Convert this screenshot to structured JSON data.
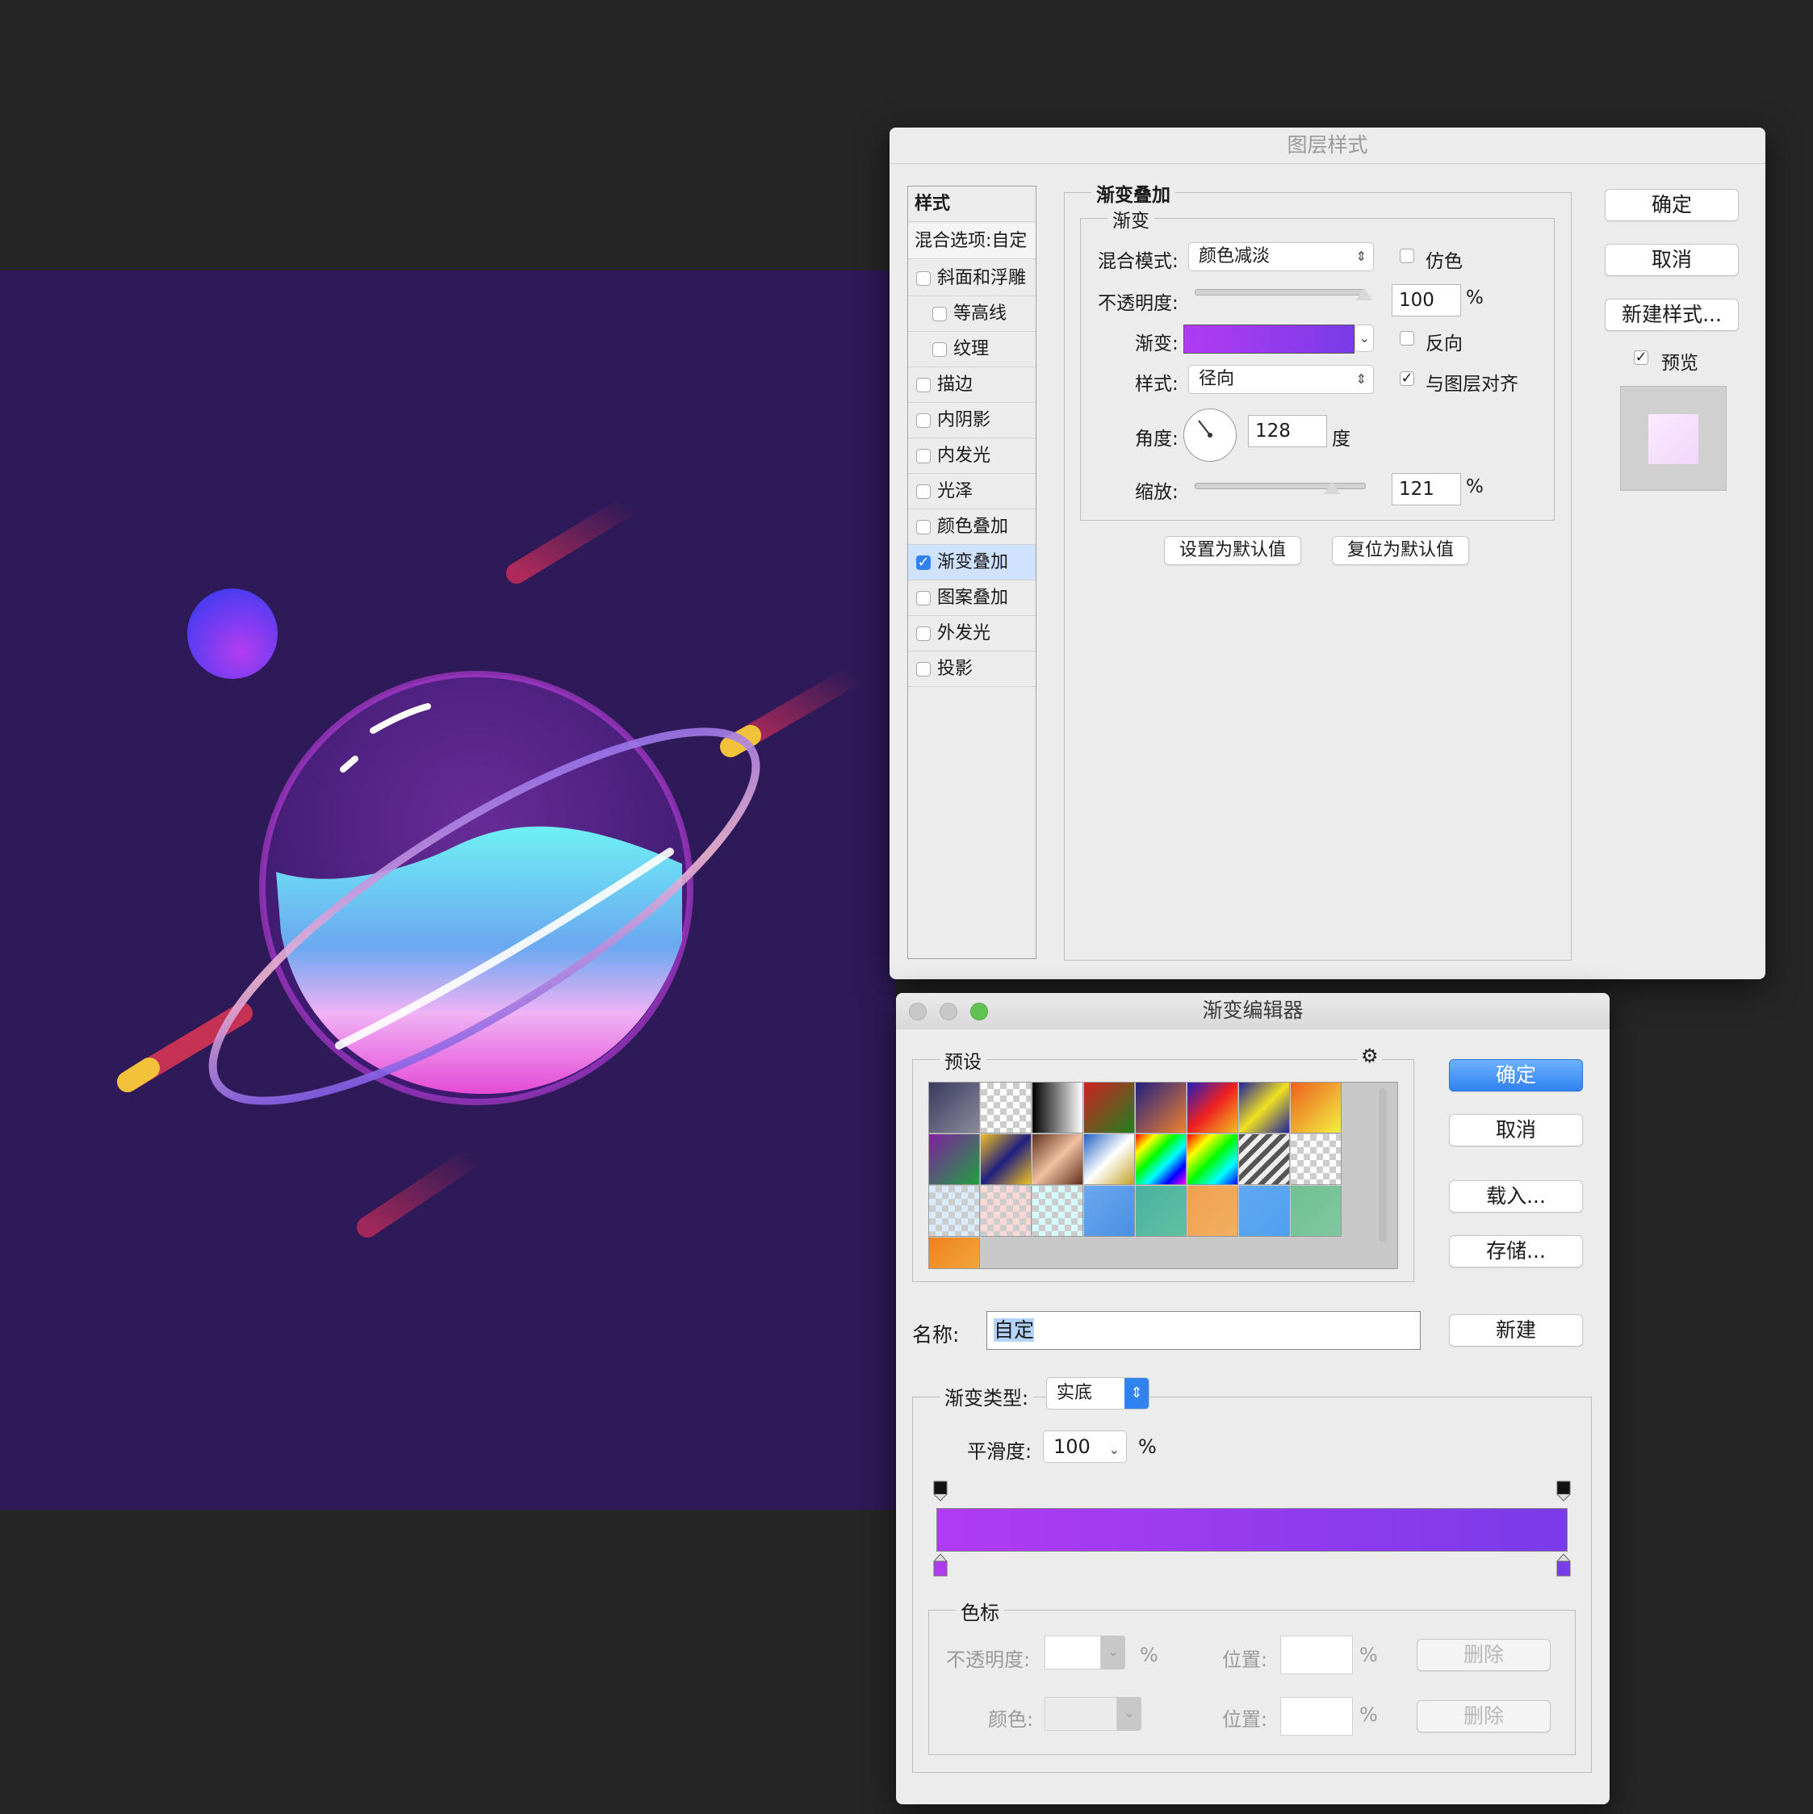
{
  "layer_style": {
    "title": "图层样式",
    "styles_header": "样式",
    "blend_options": "混合选项:自定",
    "items": [
      {
        "label": "斜面和浮雕",
        "checked": false
      },
      {
        "label": "等高线",
        "checked": false
      },
      {
        "label": "纹理",
        "checked": false
      },
      {
        "label": "描边",
        "checked": false
      },
      {
        "label": "内阴影",
        "checked": false
      },
      {
        "label": "内发光",
        "checked": false
      },
      {
        "label": "光泽",
        "checked": false
      },
      {
        "label": "颜色叠加",
        "checked": false
      },
      {
        "label": "渐变叠加",
        "checked": true
      },
      {
        "label": "图案叠加",
        "checked": false
      },
      {
        "label": "外发光",
        "checked": false
      },
      {
        "label": "投影",
        "checked": false
      }
    ],
    "section_title": "渐变叠加",
    "subsection_title": "渐变",
    "blend_mode_label": "混合模式:",
    "blend_mode_value": "颜色减淡",
    "dither_label": "仿色",
    "opacity_label": "不透明度:",
    "opacity_value": "100",
    "percent": "%",
    "gradient_label": "渐变:",
    "reverse_label": "反向",
    "style_label": "样式:",
    "style_value": "径向",
    "align_label": "与图层对齐",
    "angle_label": "角度:",
    "angle_value": "128",
    "degree": "度",
    "scale_label": "缩放:",
    "scale_value": "121",
    "set_default": "设置为默认值",
    "reset_default": "复位为默认值",
    "ok": "确定",
    "cancel": "取消",
    "new_style": "新建样式...",
    "preview_label": "预览",
    "opacity_fraction": 1.0,
    "scale_fraction": 0.81
  },
  "gradient_editor": {
    "title": "渐变编辑器",
    "presets_label": "预设",
    "ok": "确定",
    "cancel": "取消",
    "load": "载入...",
    "save": "存储...",
    "name_label": "名称:",
    "name_value": "自定",
    "new": "新建",
    "type_label": "渐变类型:",
    "type_value": "实底",
    "smooth_label": "平滑度:",
    "smooth_value": "100",
    "percent": "%",
    "stops_group": "色标",
    "stop_opacity_label": "不透明度:",
    "stop_color_label": "颜色:",
    "location_label": "位置:",
    "delete": "删除"
  },
  "colors": {
    "gradient_start": "#b13bf5",
    "gradient_end": "#7a3be8",
    "canvas_bg": "#2e1a58",
    "primary_button": "#2f82f0"
  }
}
